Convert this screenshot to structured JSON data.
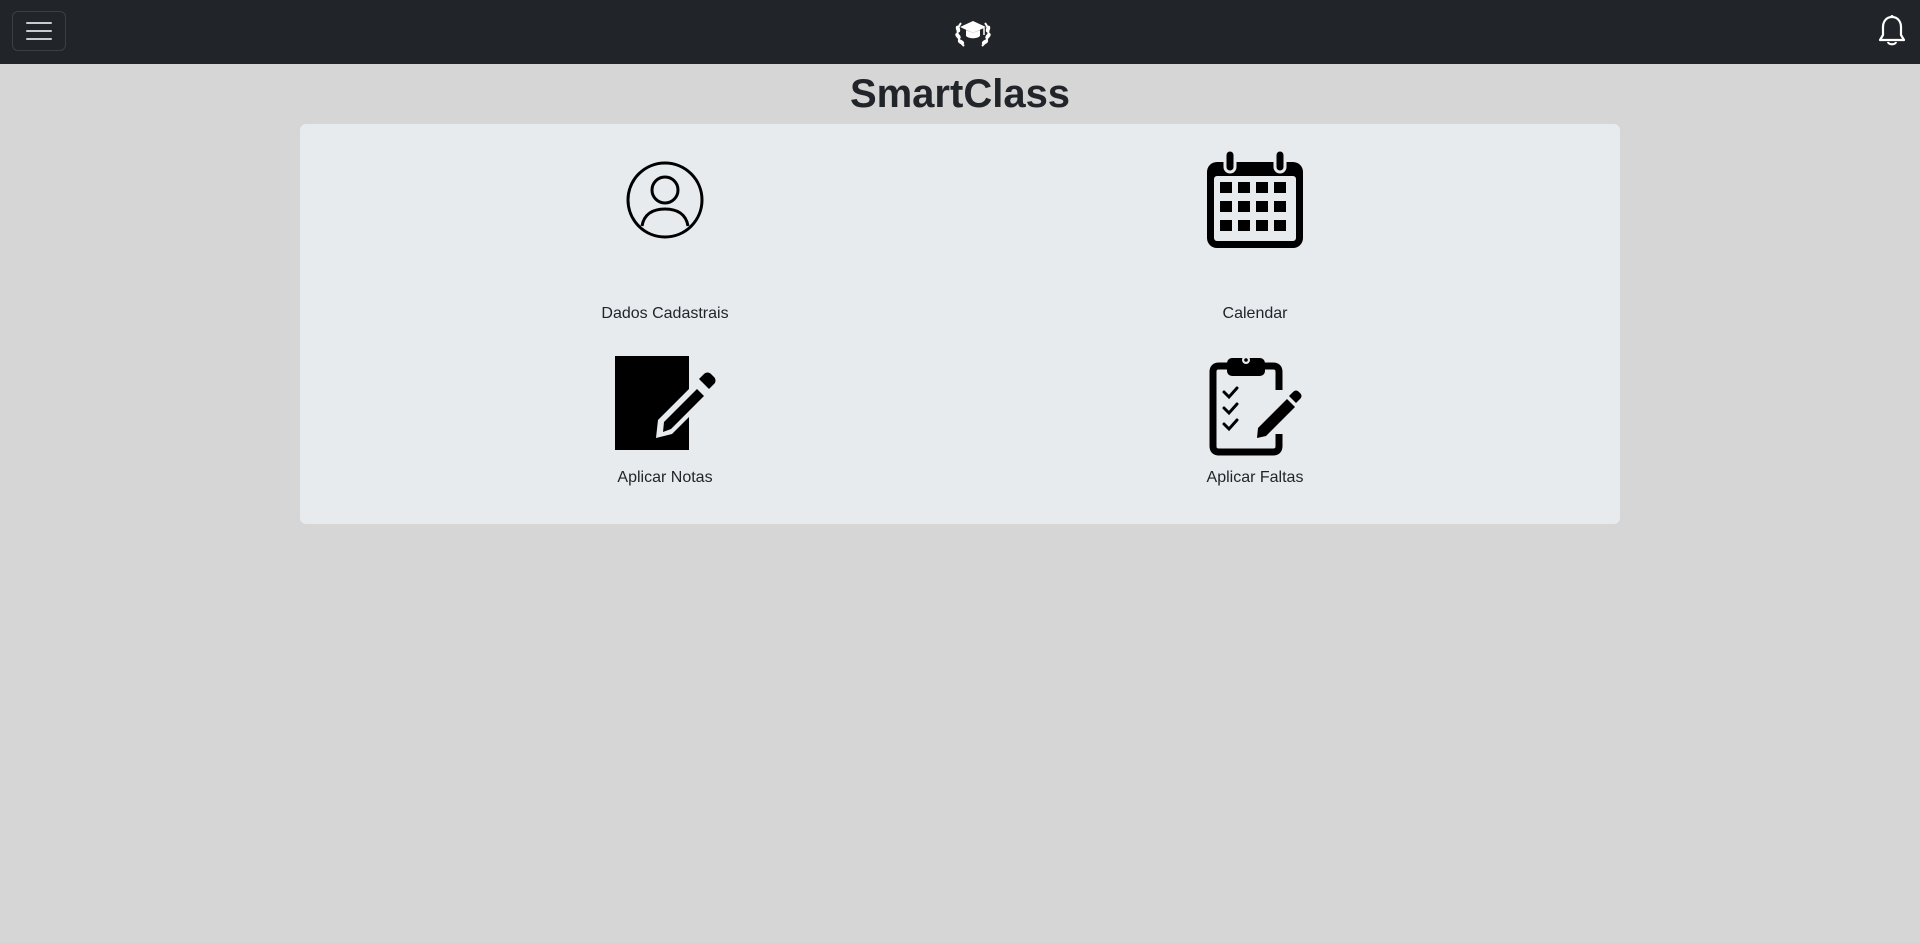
{
  "header": {
    "menu_icon": "hamburger-menu-icon",
    "logo_icon": "graduation-cap-laurel-icon",
    "notification_icon": "bell-icon"
  },
  "page": {
    "title": "SmartClass"
  },
  "tiles": [
    {
      "label": "Dados Cadastrais",
      "icon": "person-circle-icon"
    },
    {
      "label": "Calendar",
      "icon": "calendar-icon"
    },
    {
      "label": "Aplicar Notas",
      "icon": "pencil-square-icon"
    },
    {
      "label": "Aplicar Faltas",
      "icon": "clipboard-check-pencil-icon"
    }
  ],
  "colors": {
    "navbar": "#212529",
    "background": "#d6d6d6",
    "card": "#e8ebee"
  }
}
